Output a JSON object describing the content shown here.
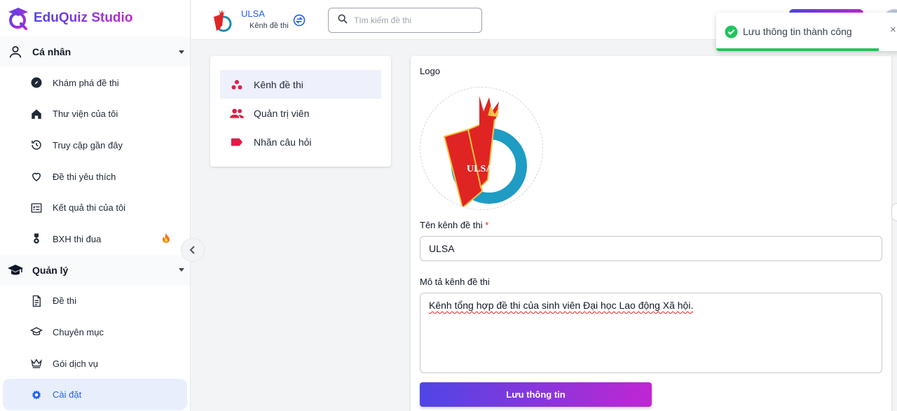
{
  "brand": {
    "name": "EduQuiz Studio",
    "logo_icon": "graduation-q-logo"
  },
  "sidebar": {
    "groups": [
      {
        "label": "Cá nhân",
        "icon": "user-icon",
        "items": [
          {
            "label": "Khám phá đề thi",
            "icon": "compass-icon"
          },
          {
            "label": "Thư viện của tôi",
            "icon": "home-icon"
          },
          {
            "label": "Truy cập gần đây",
            "icon": "history-icon"
          },
          {
            "label": "Đề thi yêu thích",
            "icon": "heart-icon"
          },
          {
            "label": "Kết quả thi của tôi",
            "icon": "checklist-icon"
          },
          {
            "label": "BXH thi đua",
            "icon": "medal-icon",
            "badge_icon": "fire-icon"
          }
        ]
      },
      {
        "label": "Quản lý",
        "icon": "graduation-cap-icon",
        "items": [
          {
            "label": "Đề thi",
            "icon": "document-icon"
          },
          {
            "label": "Chuyên mục",
            "icon": "cap-outline-icon"
          },
          {
            "label": "Gói dịch vụ",
            "icon": "crown-icon"
          },
          {
            "label": "Cài đặt",
            "icon": "gear-icon",
            "active": true
          }
        ]
      }
    ]
  },
  "header": {
    "channel_name": "ULSA",
    "channel_sub": "Kênh đề thi",
    "search_placeholder": "Tìm kiếm đề thi"
  },
  "settings_menu": [
    {
      "label": "Kênh đề thi",
      "icon": "channel-dots-icon",
      "active": true
    },
    {
      "label": "Quản trị viên",
      "icon": "users-icon"
    },
    {
      "label": "Nhãn câu hỏi",
      "icon": "tag-icon"
    }
  ],
  "form": {
    "logo_label": "Logo",
    "logo_text": "ULSA",
    "name_label": "Tên kênh đề thi",
    "required_mark": "*",
    "name_value": "ULSA",
    "desc_label": "Mô tả kênh đề thi",
    "desc_value": "Kênh tổng hợp đề thi của sinh viên Đại học Lao động Xã hội.",
    "save_label": "Lưu thông tin"
  },
  "toast": {
    "message": "Lưu thông tin thành công",
    "close_symbol": "×",
    "progress": 0.9
  },
  "colors": {
    "accent": "#2563eb",
    "gradient_start": "#4f46e5",
    "gradient_end": "#c026d3",
    "success": "#22c55e",
    "menu_icon": "#e11d48"
  }
}
